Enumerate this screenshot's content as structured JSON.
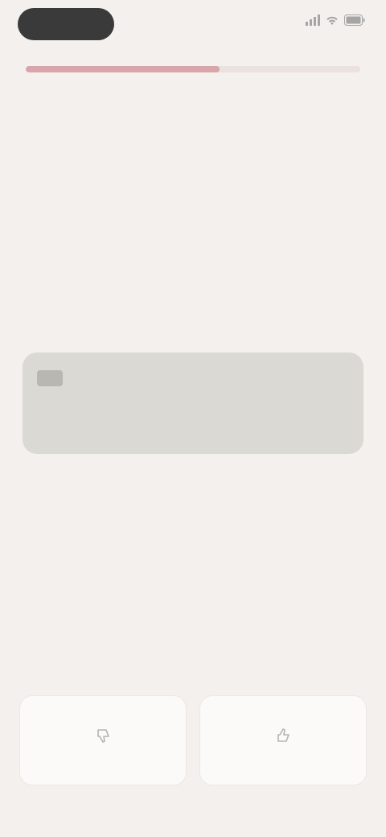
{
  "status_bar": {
    "time": "",
    "icons": [
      "signal-icon",
      "wifi-icon",
      "battery-icon"
    ]
  },
  "progress": {
    "fraction": 0.58
  },
  "prompt": {
    "text": ""
  },
  "info_card": {
    "tag": "",
    "text": ""
  },
  "answers": {
    "left_label": "",
    "left_icon": "thumbs-down-icon",
    "right_label": "",
    "right_icon": "thumbs-up-icon"
  },
  "colors": {
    "background": "#f3f0ed",
    "accent": "#d8a6aa",
    "card": "#dad9d3"
  }
}
